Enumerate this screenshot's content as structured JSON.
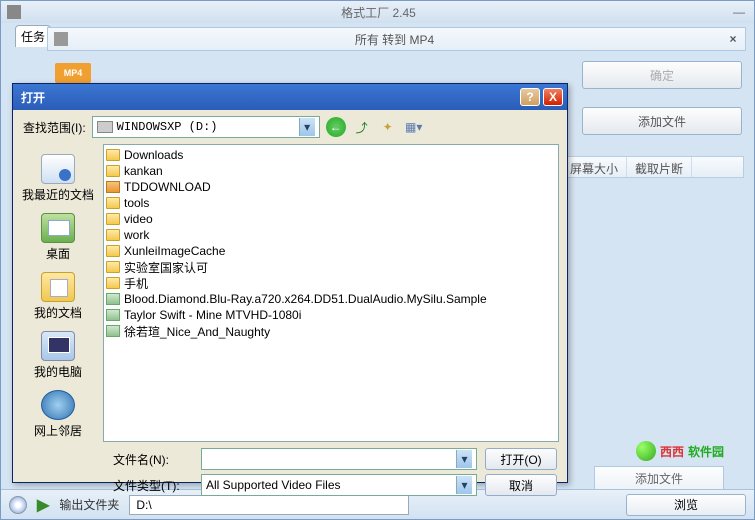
{
  "app": {
    "title": "格式工厂 2.45"
  },
  "tabs": {
    "task": "任务"
  },
  "subbar": {
    "title": "所有 转到 MP4",
    "badge": "MP4",
    "close": "×"
  },
  "right": {
    "ok": "确定",
    "add_file": "添加文件"
  },
  "cols": {
    "size": "屏幕大小",
    "crop": "截取片断"
  },
  "watermark": {
    "a": "西西",
    "b": "软件园"
  },
  "ghost_add": "添加文件",
  "bottom": {
    "label": "输出文件夹",
    "path": "D:\\",
    "browse": "浏览"
  },
  "dialog": {
    "title": "打开",
    "lookin_label": "查找范围(I):",
    "drive": "WINDOWSXP (D:)",
    "places": {
      "recent": "我最近的文档",
      "desktop": "桌面",
      "docs": "我的文档",
      "computer": "我的电脑",
      "network": "网上邻居"
    },
    "files": [
      {
        "t": "folder",
        "n": "Downloads"
      },
      {
        "t": "folder",
        "n": "kankan"
      },
      {
        "t": "dl",
        "n": "TDDOWNLOAD"
      },
      {
        "t": "folder",
        "n": "tools"
      },
      {
        "t": "folder",
        "n": "video"
      },
      {
        "t": "folder",
        "n": "work"
      },
      {
        "t": "folder",
        "n": "XunleiImageCache"
      },
      {
        "t": "folder",
        "n": "实验室国家认可"
      },
      {
        "t": "folder",
        "n": "手机"
      },
      {
        "t": "video",
        "n": "Blood.Diamond.Blu-Ray.a720.x264.DD51.DualAudio.MySilu.Sample"
      },
      {
        "t": "video",
        "n": "Taylor Swift - Mine MTVHD-1080i"
      },
      {
        "t": "video",
        "n": "徐若瑄_Nice_And_Naughty"
      }
    ],
    "filename_label": "文件名(N):",
    "filetype_label": "文件类型(T):",
    "filetype_value": "All Supported Video Files",
    "open_btn": "打开(O)",
    "cancel_btn": "取消"
  }
}
